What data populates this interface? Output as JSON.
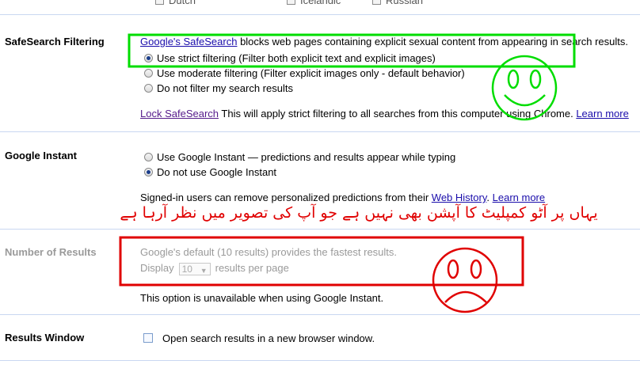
{
  "top_languages": [
    "Dutch",
    "Icelandic",
    "Russian"
  ],
  "safesearch": {
    "title": "SafeSearch Filtering",
    "desc_link": "Google's SafeSearch",
    "desc_rest": " blocks web pages containing explicit sexual content from appearing in search results.",
    "options": [
      "Use strict filtering (Filter both explicit text and explicit images)",
      "Use moderate filtering (Filter explicit images only - default behavior)",
      "Do not filter my search results"
    ],
    "selected_index": 0,
    "lock_link": "Lock SafeSearch",
    "lock_text": " This will apply strict filtering to all searches from this computer using Chrome. ",
    "learn_more": "Learn more"
  },
  "instant": {
    "title": "Google Instant",
    "options": [
      "Use Google Instant — predictions and results appear while typing",
      "Do not use Google Instant"
    ],
    "selected_index": 1,
    "note_text": "Signed-in users can remove personalized predictions from their ",
    "web_history_link": "Web History",
    "note_sep": ". ",
    "learn_more": "Learn more"
  },
  "annotation": {
    "urdu_text": "یہاں پر آٹو کمپلیٹ کا آپشن بھی نہیں ہے جو آپ کی تصویر میں نظر آرہا ہے",
    "happy_color": "#00dd00",
    "sad_color": "#e00000"
  },
  "results": {
    "title": "Number of Results",
    "default_text": "Google's default (10 results) provides the fastest results.",
    "display_label": "Display",
    "display_value": "10",
    "per_page": "results per page",
    "unavailable": "This option is unavailable when using Google Instant."
  },
  "window": {
    "title": "Results Window",
    "checkbox_label": "Open search results in a new browser window."
  }
}
